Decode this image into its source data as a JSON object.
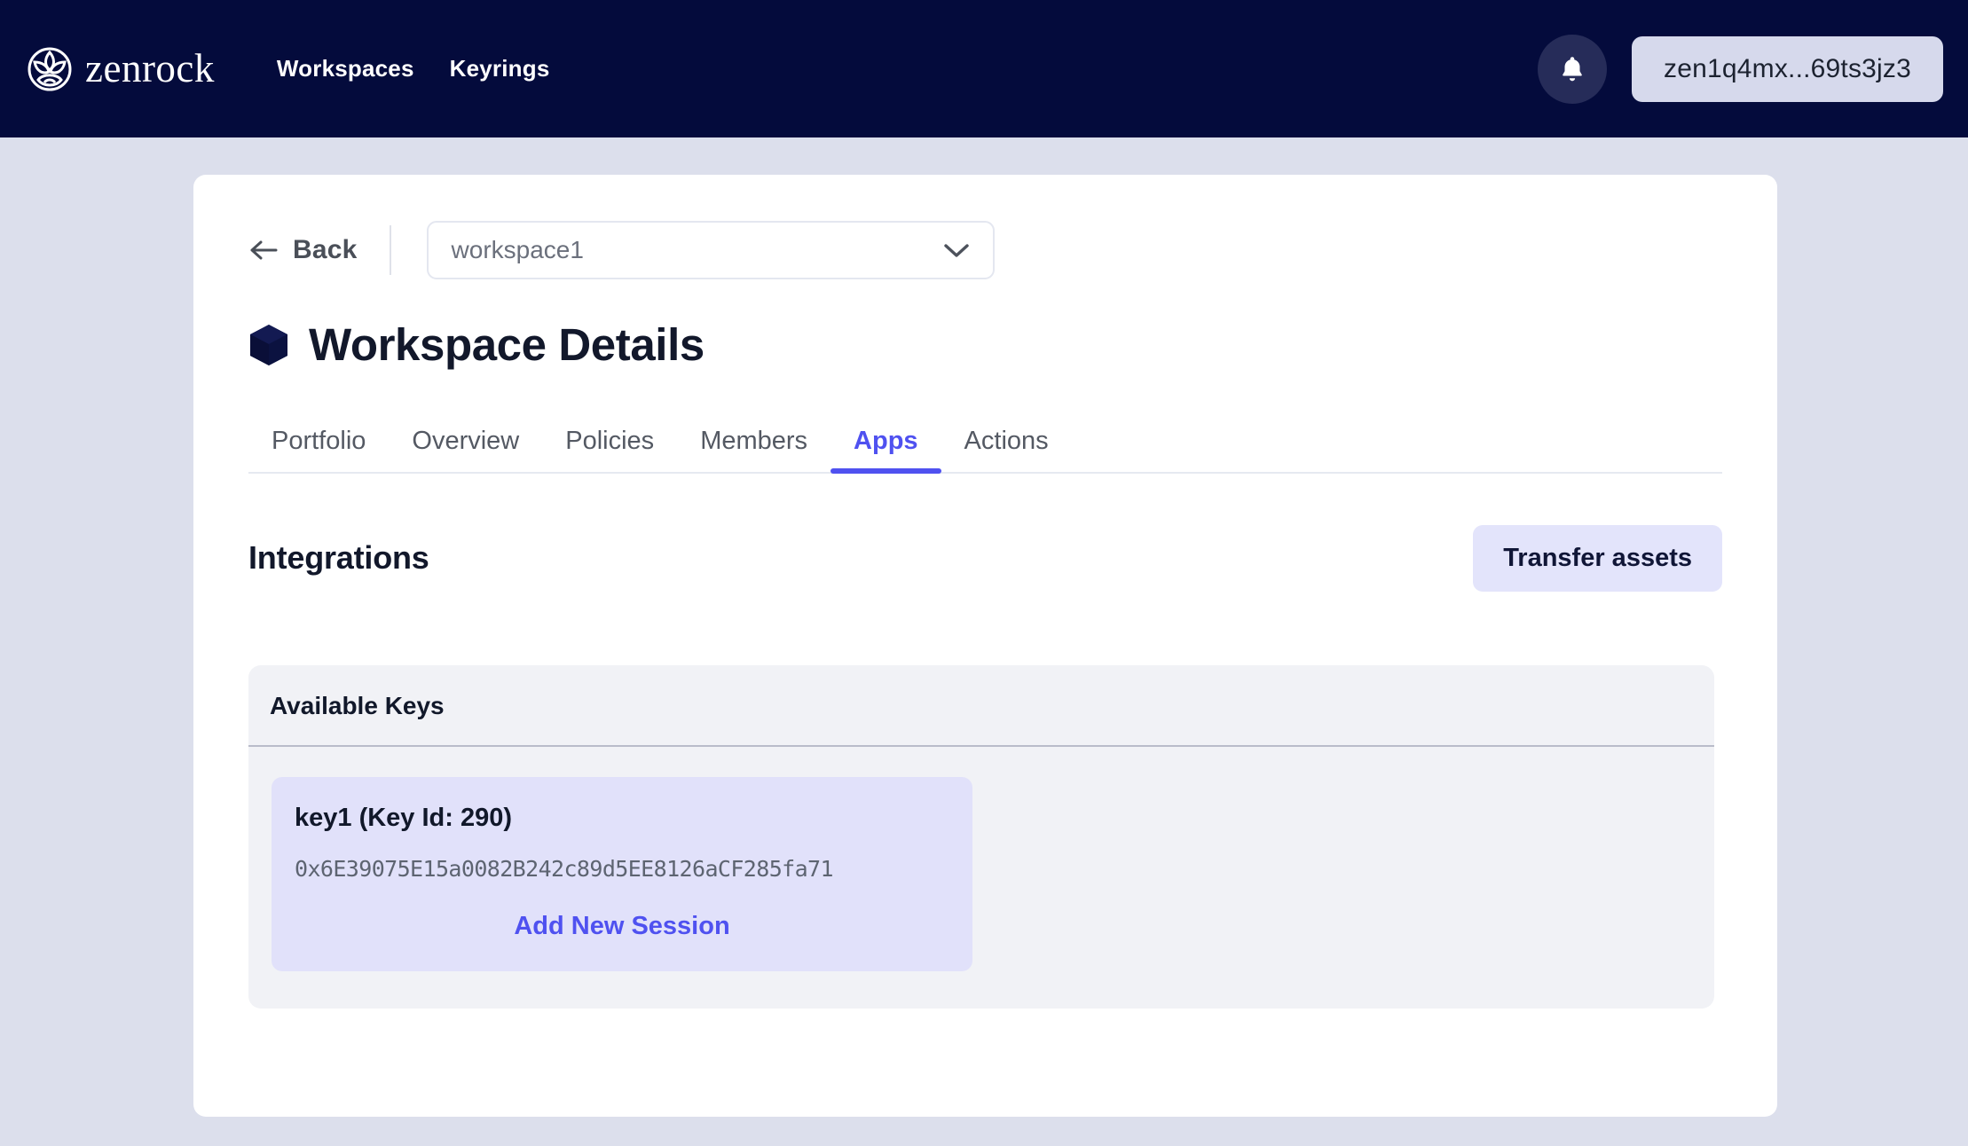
{
  "header": {
    "brand_name": "zenrock",
    "brand_icon": "zenrock-logo-icon",
    "nav": [
      {
        "label": "Workspaces"
      },
      {
        "label": "Keyrings"
      }
    ],
    "notifications_icon": "bell-icon",
    "account_address": "zen1q4mx...69ts3jz3"
  },
  "toolbar": {
    "back_label": "Back",
    "back_icon": "arrow-left-icon",
    "workspace_select_value": "workspace1",
    "workspace_select_placeholder": "workspace1",
    "chevron_icon": "chevron-down-icon"
  },
  "page": {
    "title": "Workspace Details",
    "title_icon": "cube-icon"
  },
  "tabs": [
    {
      "label": "Portfolio",
      "active": false
    },
    {
      "label": "Overview",
      "active": false
    },
    {
      "label": "Policies",
      "active": false
    },
    {
      "label": "Members",
      "active": false
    },
    {
      "label": "Apps",
      "active": true
    },
    {
      "label": "Actions",
      "active": false
    }
  ],
  "integrations": {
    "heading": "Integrations",
    "transfer_button_label": "Transfer assets",
    "keys_panel": {
      "header": "Available Keys",
      "items": [
        {
          "name": "key1 (Key Id: 290)",
          "address": "0x6E39075E15a0082B242c89d5EE8126aCF285fa71",
          "action_label": "Add New Session"
        }
      ]
    }
  },
  "colors": {
    "navy": "#040b3c",
    "page_background": "#dcdfec",
    "accent_blue": "#4f51f0",
    "lavender": "#e3e4fb",
    "key_card": "#e1e1fa",
    "panel_gray": "#f1f2f6"
  }
}
